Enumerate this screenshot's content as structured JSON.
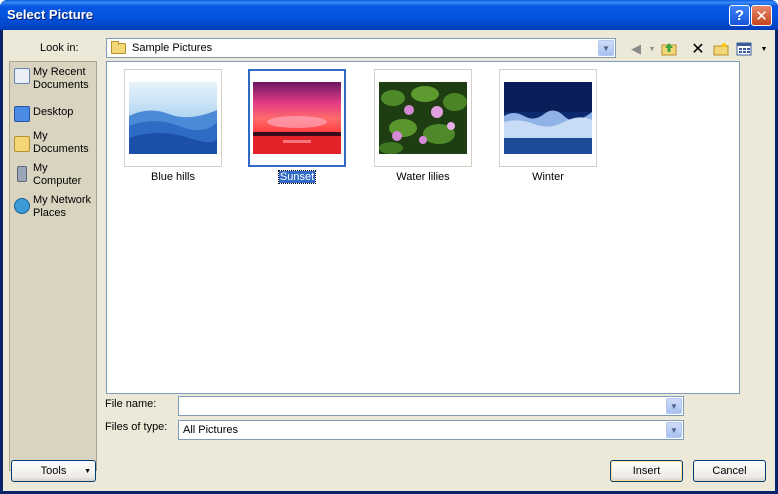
{
  "window": {
    "title": "Select Picture",
    "help_label": "?",
    "close_label": "✕"
  },
  "look_in": {
    "label": "Look in:",
    "value": "Sample Pictures"
  },
  "toolbar": {
    "icons": [
      "back-arrow-icon",
      "up-one-level-icon",
      "delete-icon",
      "new-folder-icon",
      "views-icon"
    ]
  },
  "sidebar": {
    "items": [
      {
        "label": "My Recent Documents",
        "icon": "recent-documents-icon"
      },
      {
        "label": "Desktop",
        "icon": "desktop-icon"
      },
      {
        "label": "My Documents",
        "icon": "my-documents-icon"
      },
      {
        "label": "My Computer",
        "icon": "my-computer-icon"
      },
      {
        "label": "My Network Places",
        "icon": "network-places-icon"
      }
    ]
  },
  "files": {
    "items": [
      {
        "name": "Blue hills",
        "selected": false
      },
      {
        "name": "Sunset",
        "selected": true
      },
      {
        "name": "Water lilies",
        "selected": false
      },
      {
        "name": "Winter",
        "selected": false
      }
    ]
  },
  "file_name": {
    "label": "File name:",
    "value": ""
  },
  "file_type": {
    "label": "Files of type:",
    "value": "All Pictures"
  },
  "buttons": {
    "tools": "Tools",
    "insert": "Insert",
    "cancel": "Cancel"
  },
  "colors": {
    "title_bar": "#0553dd",
    "dialog_bg": "#ece9d8",
    "selection": "#316ac5"
  }
}
